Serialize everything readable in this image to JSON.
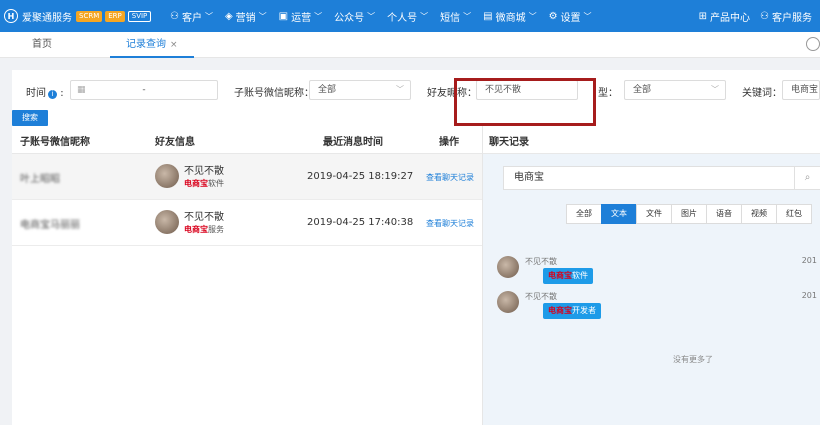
{
  "topbar": {
    "logo_glyph": "H",
    "brand": "爱聚通服务",
    "badges": [
      "SCRM",
      "ERP",
      "SVIP"
    ],
    "nav": [
      {
        "icon": "user-icon",
        "glyph": "⚇",
        "label": "客户"
      },
      {
        "icon": "cube-icon",
        "glyph": "◈",
        "label": "营销"
      },
      {
        "icon": "monitor-icon",
        "glyph": "▣",
        "label": "运营"
      },
      {
        "icon": "",
        "glyph": "",
        "label": "公众号"
      },
      {
        "icon": "",
        "glyph": "",
        "label": "个人号"
      },
      {
        "icon": "",
        "glyph": "",
        "label": "短信"
      },
      {
        "icon": "shop-icon",
        "glyph": "▤",
        "label": "微商城"
      },
      {
        "icon": "gear-icon",
        "glyph": "⚙",
        "label": "设置"
      }
    ],
    "right": [
      {
        "icon": "grid-icon",
        "glyph": "⊞",
        "label": "产品中心"
      },
      {
        "icon": "user-icon",
        "glyph": "⚇",
        "label": "客户服务"
      }
    ],
    "color": "#1e7fd8"
  },
  "tabs": {
    "home": "首页",
    "records": "记录查询",
    "close": "×"
  },
  "filters": {
    "time_label": "时间",
    "info": "i",
    "colon": ":",
    "date_sep": "-",
    "account_label": "子账号微信昵称：",
    "account_value": "全部",
    "friend_label": "好友昵称：",
    "friend_value": "不见不散",
    "type_label": "型：",
    "type_value": "全部",
    "keyword_label": "关键词：",
    "keyword_value": "电商宝",
    "search_button": "搜索"
  },
  "table": {
    "headers": [
      "子账号微信昵称",
      "好友信息",
      "最近消息时间",
      "操作"
    ],
    "rows": [
      {
        "account": "叶上昭昭",
        "friend_name": "不见不散",
        "friend_tag_red": "电商宝",
        "friend_tag_rest": "软件",
        "time": "2019-04-25 18:19:27",
        "action": "查看聊天记录"
      },
      {
        "account": "电商宝马丽丽",
        "friend_name": "不见不散",
        "friend_tag_red": "电商宝",
        "friend_tag_rest": "服务",
        "time": "2019-04-25 17:40:38",
        "action": "查看聊天记录"
      }
    ]
  },
  "chat": {
    "title": "聊天记录",
    "search_value": "电商宝",
    "tabs": [
      "全部",
      "文本",
      "文件",
      "图片",
      "语音",
      "视频",
      "红包"
    ],
    "active_tab": "文本",
    "messages": [
      {
        "sender": "不见不散",
        "red": "电商宝",
        "rest": "软件",
        "time": "201"
      },
      {
        "sender": "不见不散",
        "red": "电商宝",
        "rest": "开发者",
        "time": "201"
      }
    ],
    "no_more": "没有更多了"
  }
}
